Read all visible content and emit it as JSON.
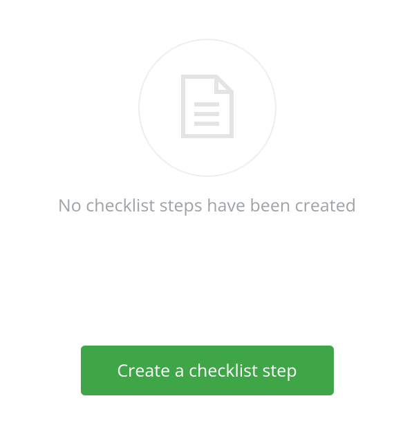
{
  "empty_state": {
    "message": "No checklist steps have been created"
  },
  "actions": {
    "create_label": "Create a checklist step"
  }
}
